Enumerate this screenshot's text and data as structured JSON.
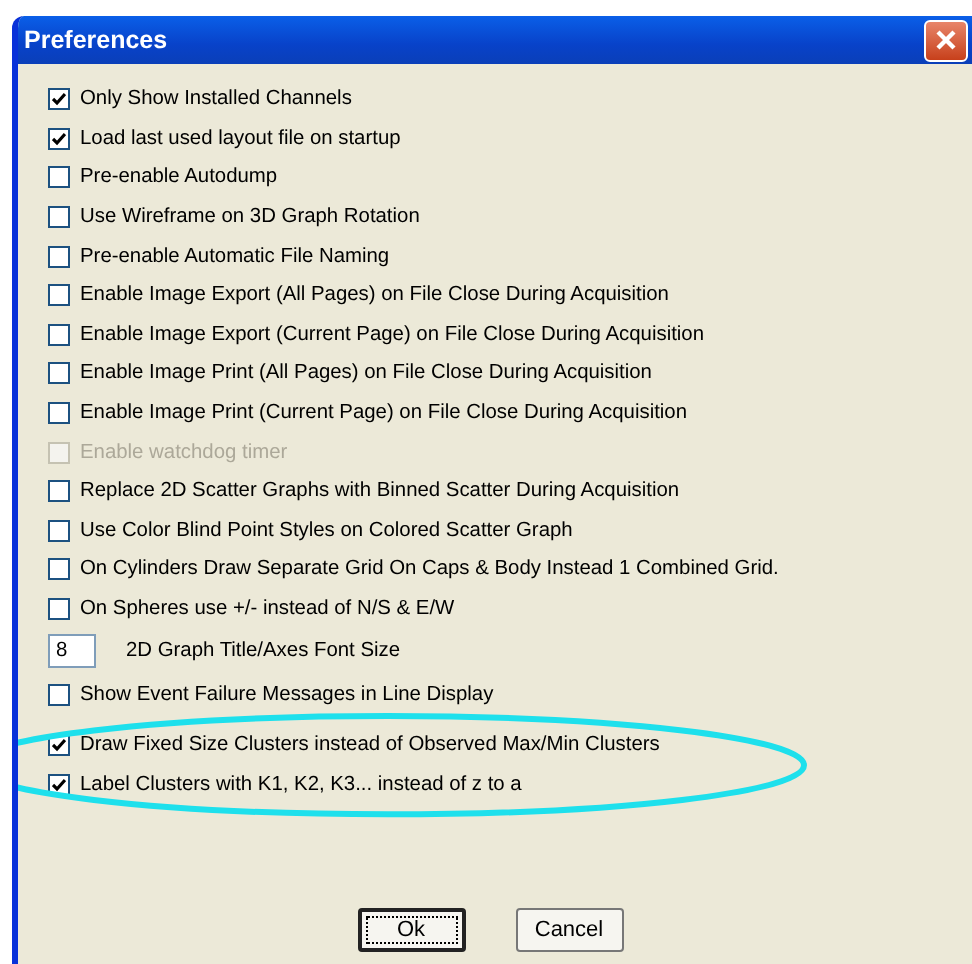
{
  "window": {
    "title": "Preferences"
  },
  "options": [
    {
      "kind": "checkbox",
      "label": "Only Show Installed Channels",
      "checked": true,
      "disabled": false,
      "highlighted": false
    },
    {
      "kind": "checkbox",
      "label": "Load last used layout file on startup",
      "checked": true,
      "disabled": false,
      "highlighted": false
    },
    {
      "kind": "checkbox",
      "label": "Pre-enable Autodump",
      "checked": false,
      "disabled": false,
      "highlighted": false
    },
    {
      "kind": "checkbox",
      "label": "Use Wireframe on 3D Graph Rotation",
      "checked": false,
      "disabled": false,
      "highlighted": false
    },
    {
      "kind": "checkbox",
      "label": "Pre-enable Automatic File Naming",
      "checked": false,
      "disabled": false,
      "highlighted": false
    },
    {
      "kind": "checkbox",
      "label": "Enable Image Export (All Pages) on File Close During Acquisition",
      "checked": false,
      "disabled": false,
      "highlighted": false
    },
    {
      "kind": "checkbox",
      "label": "Enable Image Export (Current Page) on File Close During Acquisition",
      "checked": false,
      "disabled": false,
      "highlighted": false
    },
    {
      "kind": "checkbox",
      "label": "Enable Image Print (All Pages) on File Close During Acquisition",
      "checked": false,
      "disabled": false,
      "highlighted": false
    },
    {
      "kind": "checkbox",
      "label": "Enable Image Print (Current Page) on File Close During Acquisition",
      "checked": false,
      "disabled": false,
      "highlighted": false
    },
    {
      "kind": "checkbox",
      "label": "Enable watchdog timer",
      "checked": false,
      "disabled": true,
      "highlighted": false
    },
    {
      "kind": "checkbox",
      "label": "Replace 2D Scatter Graphs with Binned Scatter During Acquisition",
      "checked": false,
      "disabled": false,
      "highlighted": false
    },
    {
      "kind": "checkbox",
      "label": "Use Color Blind Point Styles on Colored Scatter Graph",
      "checked": false,
      "disabled": false,
      "highlighted": false
    },
    {
      "kind": "checkbox",
      "label": "On Cylinders Draw Separate Grid On Caps & Body Instead 1 Combined Grid.",
      "checked": false,
      "disabled": false,
      "highlighted": false
    },
    {
      "kind": "checkbox",
      "label": "On Spheres use +/- instead of N/S & E/W",
      "checked": false,
      "disabled": false,
      "highlighted": false
    },
    {
      "kind": "number",
      "label": "2D Graph Title/Axes Font Size",
      "value": "8",
      "highlighted": false
    },
    {
      "kind": "checkbox",
      "label": "Show Event Failure Messages in Line Display",
      "checked": false,
      "disabled": false,
      "highlighted": false
    },
    {
      "kind": "checkbox",
      "label": "Draw Fixed Size Clusters instead of Observed Max/Min Clusters",
      "checked": true,
      "disabled": false,
      "highlighted": true
    },
    {
      "kind": "checkbox",
      "label": "Label Clusters with K1, K2, K3...  instead of z to a",
      "checked": true,
      "disabled": false,
      "highlighted": true
    }
  ],
  "buttons": [
    {
      "label": "Ok",
      "default": true
    },
    {
      "label": "Cancel",
      "default": false
    }
  ]
}
